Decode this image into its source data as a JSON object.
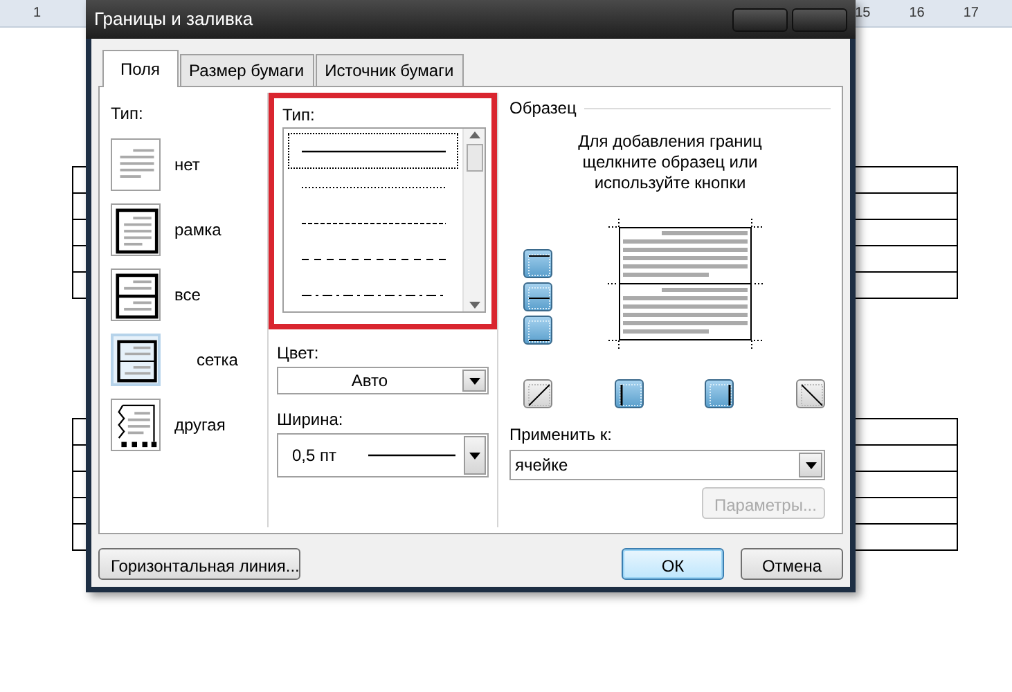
{
  "ruler": {
    "left_numbers": [
      "1"
    ],
    "right_numbers": [
      "15",
      "16",
      "17"
    ]
  },
  "window": {
    "title": "Границы и заливка"
  },
  "tabs": [
    {
      "label": "Поля",
      "selected": true
    },
    {
      "label": "Размер бумаги",
      "selected": false
    },
    {
      "label": "Источник бумаги",
      "selected": false
    }
  ],
  "setting": {
    "label": "Тип:",
    "items": [
      {
        "label": "нет",
        "kind": "none",
        "selected": false
      },
      {
        "label": "рамка",
        "kind": "box",
        "selected": false
      },
      {
        "label": "все",
        "kind": "all",
        "selected": false
      },
      {
        "label": "сетка",
        "kind": "grid",
        "selected": true
      },
      {
        "label": "другая",
        "kind": "custom",
        "selected": false
      }
    ]
  },
  "style": {
    "label": "Тип:",
    "highlighted": true,
    "lines": [
      {
        "kind": "solid",
        "selected": true
      },
      {
        "kind": "dotted",
        "selected": false
      },
      {
        "kind": "fine-dash",
        "selected": false
      },
      {
        "kind": "dash",
        "selected": false
      },
      {
        "kind": "dash-dot",
        "selected": false
      }
    ]
  },
  "color": {
    "label": "Цвет:",
    "value": "Авто"
  },
  "width": {
    "label": "Ширина:",
    "value": "0,5 пт"
  },
  "preview": {
    "title": "Образец",
    "hint": "Для добавления границ щелкните образец или используйте кнопки",
    "side_buttons": [
      {
        "kind": "top",
        "on": true
      },
      {
        "kind": "middle",
        "on": true
      },
      {
        "kind": "bottom",
        "on": true
      }
    ],
    "bottom_buttons": [
      {
        "kind": "diag-up",
        "on": false
      },
      {
        "kind": "left",
        "on": true
      },
      {
        "kind": "right",
        "on": true
      },
      {
        "kind": "diag-down",
        "on": false
      }
    ]
  },
  "apply_to": {
    "label": "Применить к:",
    "value": "ячейке"
  },
  "options_button": {
    "label": "Параметры...",
    "disabled": true
  },
  "buttons": [
    {
      "label": "Горизонтальная линия...",
      "default": false
    },
    {
      "label": "ОК",
      "default": true
    },
    {
      "label": "Отмена",
      "default": false
    }
  ]
}
